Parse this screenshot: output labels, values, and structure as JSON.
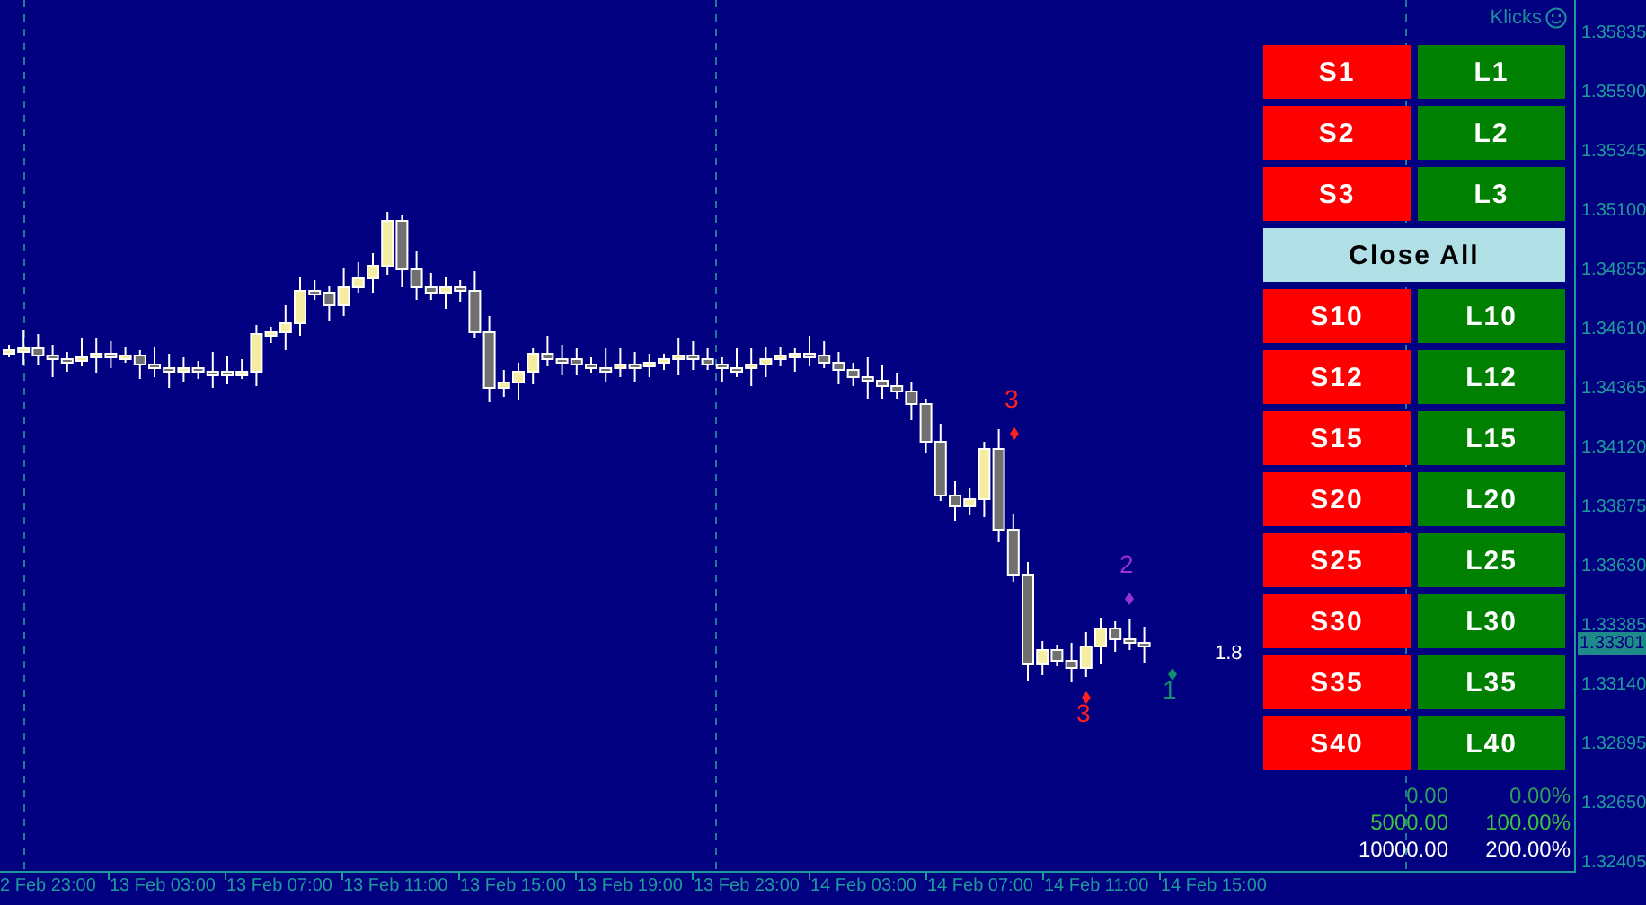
{
  "chart_header": {
    "label": "Klicks"
  },
  "buttons": [
    {
      "kind": "pair",
      "short": "S1",
      "long": "L1"
    },
    {
      "kind": "pair",
      "short": "S2",
      "long": "L2"
    },
    {
      "kind": "pair",
      "short": "S3",
      "long": "L3"
    },
    {
      "kind": "wide",
      "label": "Close All"
    },
    {
      "kind": "pair",
      "short": "S10",
      "long": "L10"
    },
    {
      "kind": "pair",
      "short": "S12",
      "long": "L12"
    },
    {
      "kind": "pair",
      "short": "S15",
      "long": "L15"
    },
    {
      "kind": "pair",
      "short": "S20",
      "long": "L20"
    },
    {
      "kind": "pair",
      "short": "S25",
      "long": "L25"
    },
    {
      "kind": "pair",
      "short": "S30",
      "long": "L30"
    },
    {
      "kind": "pair",
      "short": "S35",
      "long": "L35"
    },
    {
      "kind": "pair",
      "short": "S40",
      "long": "L40"
    }
  ],
  "stats": [
    {
      "amount": "0.00",
      "percent": "0.00%",
      "color": "#2e9e5e"
    },
    {
      "amount": "5000.00",
      "percent": "100.00%",
      "color": "#3cc040"
    },
    {
      "amount": "10000.00",
      "percent": "200.00%",
      "color": "#ffffff"
    }
  ],
  "markers": [
    {
      "label": "3",
      "color": "#ff2020"
    },
    {
      "label": "2",
      "color": "#9a30d8"
    },
    {
      "label": "3",
      "color": "#ff2020"
    },
    {
      "label": "1",
      "color": "#109070"
    }
  ],
  "spread_label": "1.8",
  "price_axis": {
    "labels": [
      "1.35835",
      "1.35590",
      "1.35345",
      "1.35100",
      "1.34855",
      "1.34610",
      "1.34365",
      "1.34120",
      "1.33875",
      "1.33630",
      "1.33385",
      "1.33140",
      "1.32895",
      "1.32650",
      "1.32405"
    ],
    "current": "1.33301"
  },
  "time_axis": {
    "labels": [
      "2 Feb 23:00",
      "13 Feb 03:00",
      "13 Feb 07:00",
      "13 Feb 11:00",
      "13 Feb 15:00",
      "13 Feb 19:00",
      "13 Feb 23:00",
      "14 Feb 03:00",
      "14 Feb 07:00",
      "14 Feb 11:00",
      "14 Feb 15:00"
    ]
  }
}
